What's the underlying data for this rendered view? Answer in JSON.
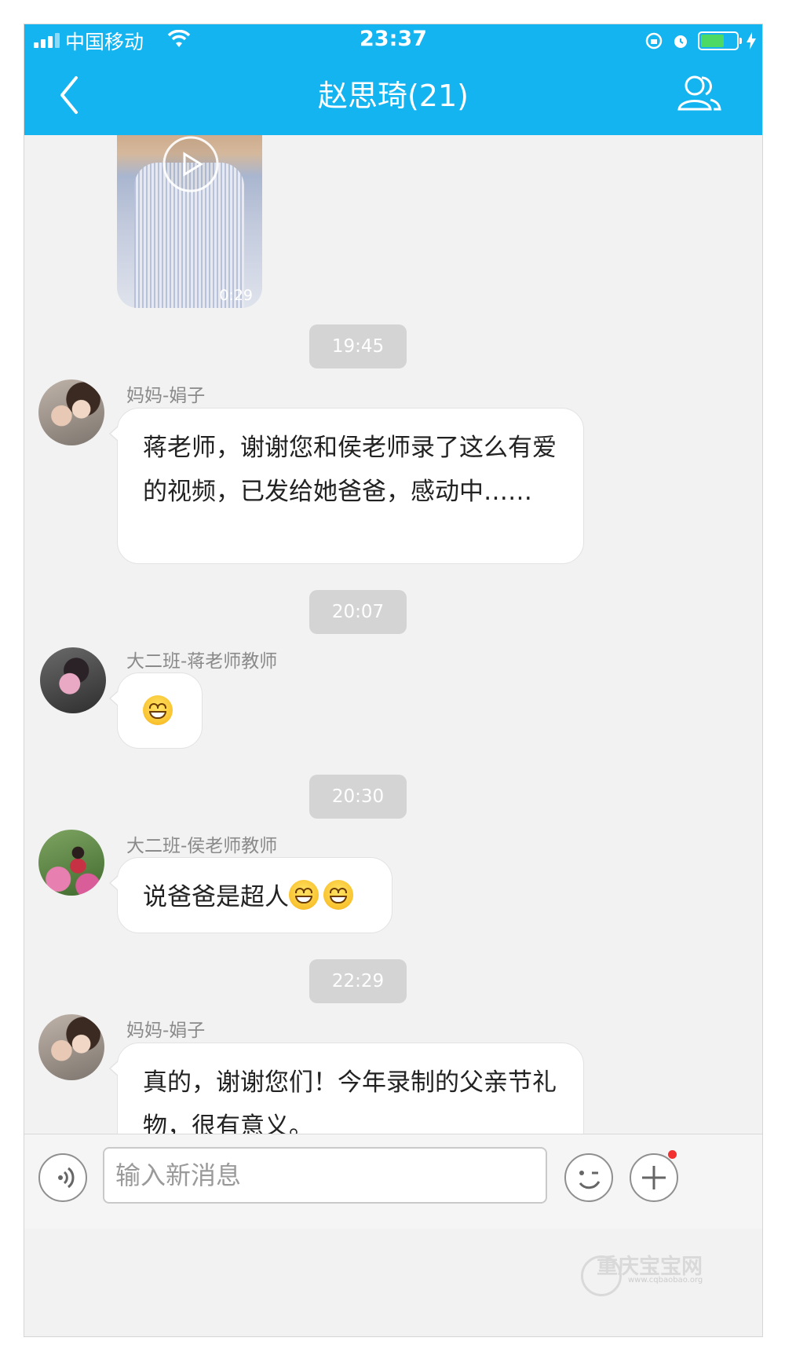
{
  "status_bar": {
    "carrier": "中国移动",
    "time": "23:37"
  },
  "header": {
    "title": "赵思琦(21)",
    "back_icon": "chevron-left-icon",
    "members_icon": "group-members-icon",
    "bg_color": "#14b4f0"
  },
  "messages": {
    "video": {
      "duration": "0:29"
    },
    "ts1": "19:45",
    "m1": {
      "sender": "妈妈-娟子",
      "text": "蒋老师，谢谢您和侯老师录了这么有爱的视频，已发给她爸爸，感动中……"
    },
    "ts2": "20:07",
    "m2": {
      "sender": "大二班-蒋老师教师",
      "emoji": "grinning-face"
    },
    "ts3": "20:30",
    "m3": {
      "sender": "大二班-侯老师教师",
      "text": "说爸爸是超人",
      "emoji": "grinning-face x2"
    },
    "ts4": "22:29",
    "m4": {
      "sender": "妈妈-娟子",
      "text": "真的，谢谢您们！今年录制的父亲节礼物，很有意义。"
    }
  },
  "input_bar": {
    "voice_icon": "voice-icon",
    "placeholder": "输入新消息",
    "emoji_icon": "emoji-wink-icon",
    "plus_icon": "plus-icon"
  },
  "watermark": {
    "text": "重庆宝宝网",
    "sub": "www.cqbaobao.org"
  }
}
